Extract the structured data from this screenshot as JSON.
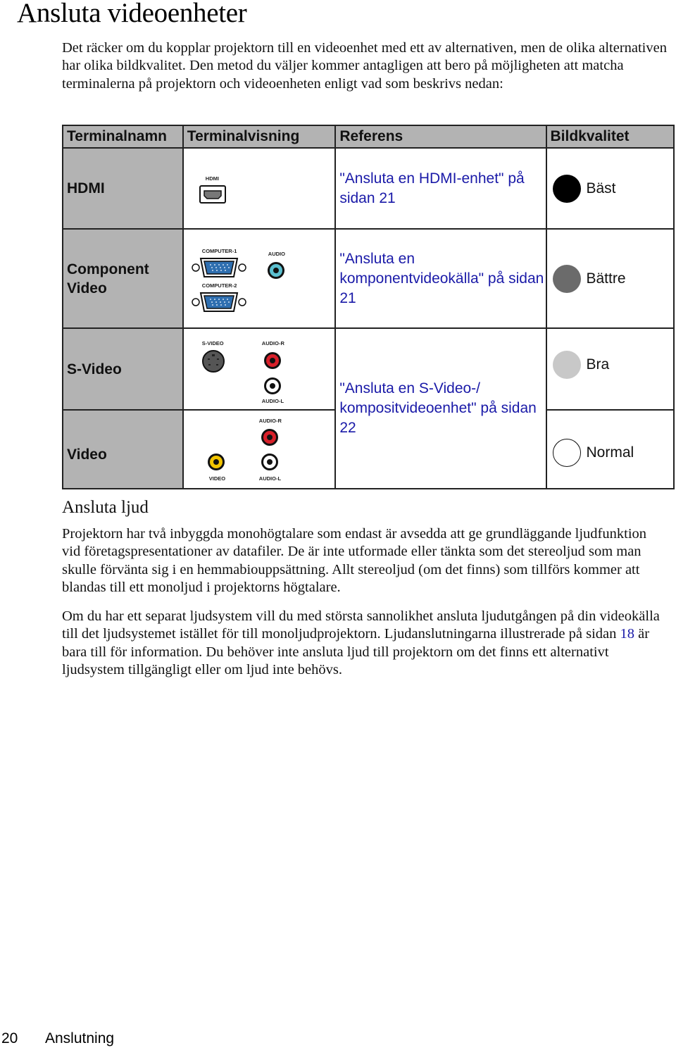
{
  "page": {
    "title": "Ansluta videoenheter",
    "intro": "Det räcker om du kopplar projektorn till en videoenhet med ett av alternativen, men de olika alternativen har olika bildkvalitet. Den metod du väljer kommer antagligen att bero på möjligheten att matcha terminalerna på projektorn och videoenheten enligt vad som beskrivs nedan:"
  },
  "table": {
    "headers": [
      "Terminalnamn",
      "Terminalvisning",
      "Referens",
      "Bildkvalitet"
    ],
    "rows": [
      {
        "name": "HDMI",
        "ports": [
          "HDMI"
        ],
        "reference": "\"Ansluta en HDMI-enhet\" på sidan 21",
        "quality": "Bäst",
        "quality_color": "#000000"
      },
      {
        "name": "Component Video",
        "ports": [
          "COMPUTER-1",
          "COMPUTER-2",
          "AUDIO"
        ],
        "reference": "\"Ansluta en komponentvideokälla\" på sidan 21",
        "quality": "Bättre",
        "quality_color": "#6b6b6b"
      },
      {
        "name": "S-Video",
        "ports": [
          "S-VIDEO",
          "AUDIO-R",
          "AUDIO-L"
        ],
        "reference": "\"Ansluta en S-Video-/ kompositvideoenhet\" på sidan 22",
        "quality": "Bra",
        "quality_color": "#c8c8c8"
      },
      {
        "name": "Video",
        "ports": [
          "AUDIO-R",
          "VIDEO",
          "AUDIO-L"
        ],
        "reference": "\"Ansluta en S-Video-/ kompositvideoenhet\" på sidan 22",
        "quality": "Normal",
        "quality_color": "#ffffff"
      }
    ]
  },
  "audio": {
    "heading": "Ansluta ljud",
    "para1": "Projektorn har två inbyggda monohögtalare som endast är avsedda att ge grundläggande ljudfunktion vid företagspresentationer av datafiler. De är inte utformade eller tänkta som det stereoljud som man skulle förvänta sig i en hemmabiouppsättning. Allt stereoljud (om det finns) som tillförs kommer att blandas till ett monoljud i projektorns högtalare.",
    "para2_before": "Om du har ett separat ljudsystem vill du med största sannolikhet ansluta ljudutgången på din videokälla till det ljudsystemet istället för till monoljudprojektorn. Ljudanslutningarna illustrerade på sidan ",
    "para2_link": "18",
    "para2_after": " är bara till för information. Du behöver inte ansluta ljud till projektorn om det finns ett alternativt ljudsystem tillgängligt eller om ljud inte behövs."
  },
  "footer": {
    "page_number": "20",
    "section": "Anslutning"
  },
  "colors": {
    "header_bg": "#b3b3b3",
    "link": "#1a1aa8",
    "audio_red": "#d8202a",
    "audio_white": "#ffffff",
    "video_yellow": "#f2c400",
    "vga_blue": "#2f6fb0",
    "audio_cyan": "#5bc0d0"
  }
}
